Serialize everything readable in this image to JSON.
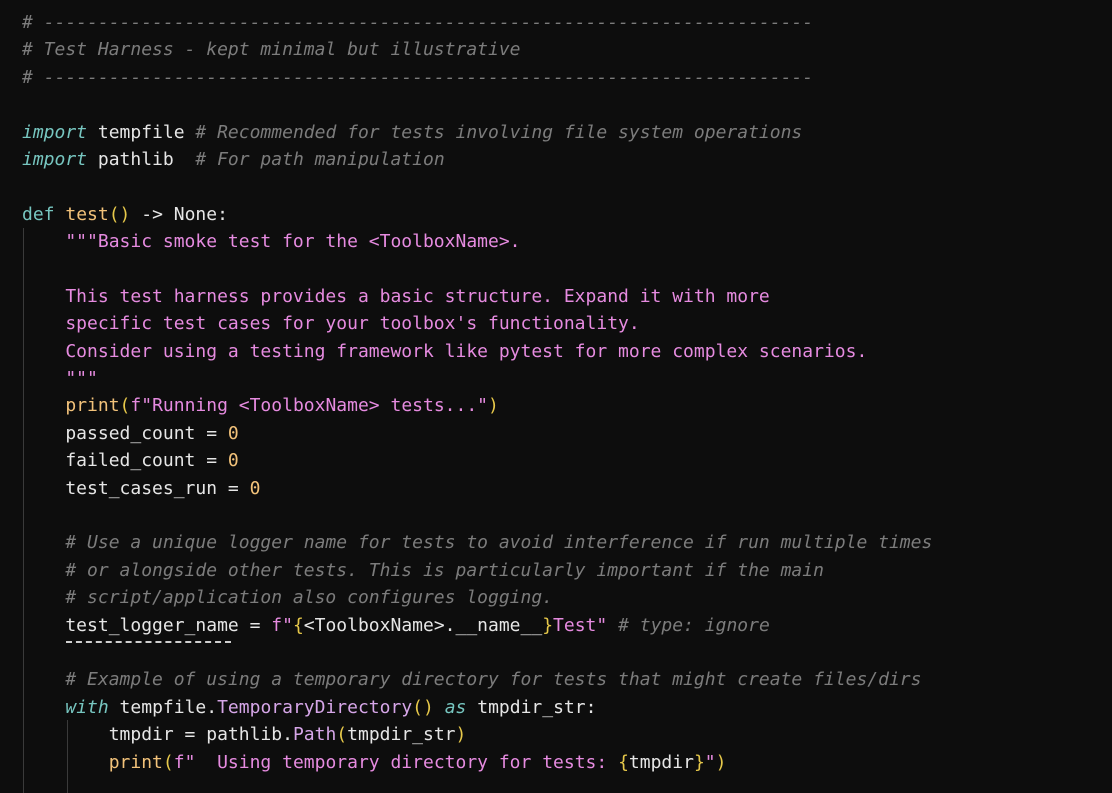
{
  "editor": {
    "lines": [
      [
        {
          "t": "# -----------------------------------------------------------------------",
          "c": "comment"
        }
      ],
      [
        {
          "t": "# Test Harness - kept minimal but illustrative",
          "c": "comment"
        }
      ],
      [
        {
          "t": "# -----------------------------------------------------------------------",
          "c": "comment"
        }
      ],
      [],
      [
        {
          "t": "import",
          "c": "kw"
        },
        {
          "t": " tempfile ",
          "c": "id"
        },
        {
          "t": "# Recommended for tests involving file system operations",
          "c": "comment"
        }
      ],
      [
        {
          "t": "import",
          "c": "kw"
        },
        {
          "t": " pathlib  ",
          "c": "id"
        },
        {
          "t": "# For path manipulation",
          "c": "comment"
        }
      ],
      [],
      [
        {
          "t": "def",
          "c": "def"
        },
        {
          "t": " ",
          "c": "plain"
        },
        {
          "t": "test",
          "c": "fn"
        },
        {
          "t": "()",
          "c": "paren"
        },
        {
          "t": " -> None:",
          "c": "plain"
        }
      ],
      [
        {
          "t": "    \"\"\"Basic smoke test for the <ToolboxName>.",
          "c": "str"
        }
      ],
      [],
      [
        {
          "t": "    This test harness provides a basic structure. Expand it with more",
          "c": "str"
        }
      ],
      [
        {
          "t": "    specific test cases for your toolbox's functionality.",
          "c": "str"
        }
      ],
      [
        {
          "t": "    Consider using a testing framework like pytest for more complex scenarios.",
          "c": "str"
        }
      ],
      [
        {
          "t": "    \"\"\"",
          "c": "str"
        }
      ],
      [
        {
          "t": "    ",
          "c": "plain"
        },
        {
          "t": "print",
          "c": "fn"
        },
        {
          "t": "(",
          "c": "paren"
        },
        {
          "t": "f\"Running <ToolboxName> tests...\"",
          "c": "str"
        },
        {
          "t": ")",
          "c": "paren"
        }
      ],
      [
        {
          "t": "    passed_count = ",
          "c": "id"
        },
        {
          "t": "0",
          "c": "num"
        }
      ],
      [
        {
          "t": "    failed_count = ",
          "c": "id"
        },
        {
          "t": "0",
          "c": "num"
        }
      ],
      [
        {
          "t": "    test_cases_run = ",
          "c": "id"
        },
        {
          "t": "0",
          "c": "num"
        }
      ],
      [],
      [
        {
          "t": "    # Use a unique logger name for tests to avoid interference if run multiple times",
          "c": "comment"
        }
      ],
      [
        {
          "t": "    # or alongside other tests. This is particularly important if the main",
          "c": "comment"
        }
      ],
      [
        {
          "t": "    # script/application also configures logging.",
          "c": "comment"
        }
      ],
      [
        {
          "t": "    test_logger_name = ",
          "c": "id"
        },
        {
          "t": "f\"",
          "c": "str"
        },
        {
          "t": "{",
          "c": "paren"
        },
        {
          "t": "<ToolboxName>.__name__",
          "c": "id"
        },
        {
          "t": "}",
          "c": "paren"
        },
        {
          "t": "Test\"",
          "c": "str"
        },
        {
          "t": " # type: ignore",
          "c": "comment"
        }
      ],
      [],
      [
        {
          "t": "    # Example of using a temporary directory for tests that might create files/dirs",
          "c": "comment"
        }
      ],
      [
        {
          "t": "    ",
          "c": "plain"
        },
        {
          "t": "with",
          "c": "kw"
        },
        {
          "t": " tempfile.",
          "c": "id"
        },
        {
          "t": "TemporaryDirectory",
          "c": "method"
        },
        {
          "t": "()",
          "c": "paren"
        },
        {
          "t": " ",
          "c": "plain"
        },
        {
          "t": "as",
          "c": "kw"
        },
        {
          "t": " tmpdir_str:",
          "c": "id"
        }
      ],
      [
        {
          "t": "        tmpdir = pathlib.",
          "c": "id"
        },
        {
          "t": "Path",
          "c": "method"
        },
        {
          "t": "(",
          "c": "paren"
        },
        {
          "t": "tmpdir_str",
          "c": "id"
        },
        {
          "t": ")",
          "c": "paren"
        }
      ],
      [
        {
          "t": "        ",
          "c": "plain"
        },
        {
          "t": "print",
          "c": "fn"
        },
        {
          "t": "(",
          "c": "paren"
        },
        {
          "t": "f\"  Using temporary directory for tests: ",
          "c": "str"
        },
        {
          "t": "{",
          "c": "paren"
        },
        {
          "t": "tmpdir",
          "c": "id"
        },
        {
          "t": "}",
          "c": "paren"
        },
        {
          "t": "\"",
          "c": "str"
        },
        {
          "t": ")",
          "c": "paren"
        }
      ]
    ]
  }
}
